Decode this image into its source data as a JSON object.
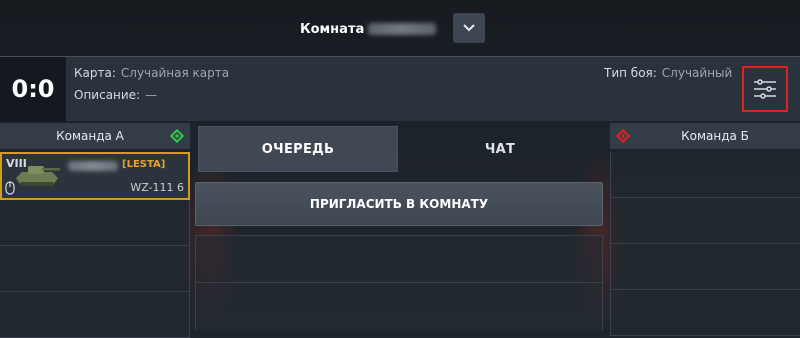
{
  "room": {
    "title": "Комната",
    "name_obscured": true
  },
  "info": {
    "score": "0:0",
    "map_label": "Карта:",
    "map_value": "Случайная карта",
    "description_label": "Описание:",
    "description_value": "—",
    "battle_type_label": "Тип боя:",
    "battle_type_value": "Случайный"
  },
  "team_a": {
    "title": "Команда А",
    "color": "#2ecc40",
    "player": {
      "tier": "VIII",
      "clan": "[LESTA]",
      "vehicle": "WZ-111 6"
    }
  },
  "team_b": {
    "title": "Команда Б",
    "color": "#e0201f"
  },
  "tabs": {
    "queue": "ОЧЕРЕДЬ",
    "chat": "ЧАТ"
  },
  "invite_button": "ПРИГЛАСИТЬ В КОМНАТУ",
  "icons": {
    "dropdown": "chevron-down-icon",
    "settings": "sliders-icon",
    "team_a_marker": "diamond-icon",
    "team_b_marker": "diamond-icon",
    "tank": "tank-icon",
    "mouse": "mouse-icon"
  },
  "colors": {
    "highlight": "#e0201f",
    "selected_slot": "#d69a1c",
    "clan_tag": "#e3a530"
  }
}
